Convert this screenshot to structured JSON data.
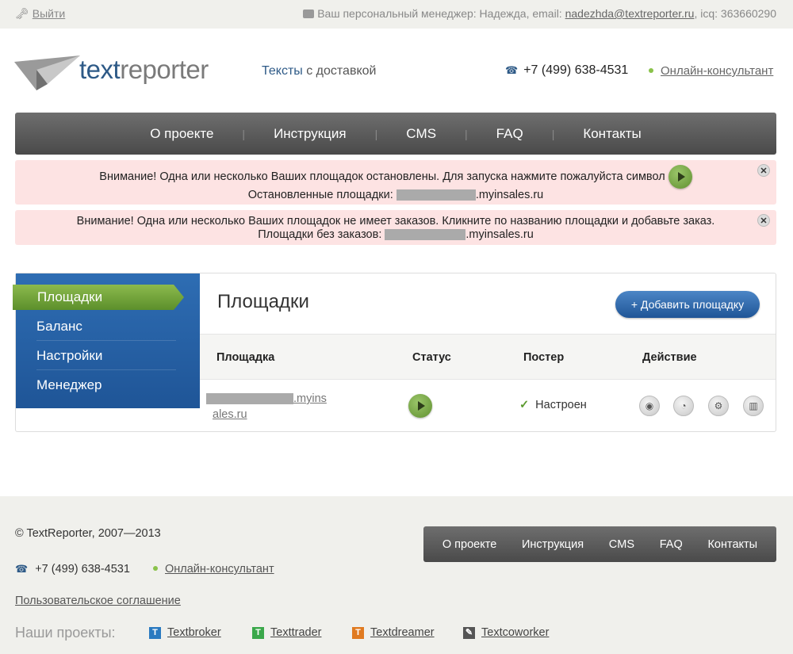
{
  "topbar": {
    "logout": "Выйти",
    "manager_text": "Ваш персональный менеджер: Надежда, email:",
    "manager_email": "nadezhda@textreporter.ru",
    "icq": ", icq: 363660290"
  },
  "header": {
    "logo_part1": "text",
    "logo_part2": "reporter",
    "tagline_hl": "Тексты",
    "tagline_rest": " с доставкой",
    "phone": "+7 (499) 638-4531",
    "online": "Онлайн-консультант"
  },
  "nav": [
    "О проекте",
    "Инструкция",
    "CMS",
    "FAQ",
    "Контакты"
  ],
  "alerts": {
    "a1_line1": "Внимание! Одна или несколько Ваших площадок остановлены. Для запуска нажмите пожалуйста символ",
    "a1_line2_prefix": "Остановленные площадки:",
    "a1_line2_suffix": ".myinsales.ru",
    "a2_line1": "Внимание! Одна или несколько Ваших площадок не имеет заказов. Кликните по названию площадки и добавьте заказ.",
    "a2_line2_prefix": "Площадки без заказов:",
    "a2_line2_suffix": ".myinsales.ru"
  },
  "sidebar": [
    "Площадки",
    "Баланс",
    "Настройки",
    "Менеджер"
  ],
  "main": {
    "title": "Площадки",
    "add_button": "+ Добавить площадку",
    "columns": [
      "Площадка",
      "Статус",
      "Постер",
      "Действие"
    ],
    "row": {
      "site_suffix1": ".myins",
      "site_suffix2": "ales.ru",
      "poster": "Настроен"
    }
  },
  "footer": {
    "copyright": "© TextReporter, 2007—2013",
    "nav": [
      "О проекте",
      "Инструкция",
      "CMS",
      "FAQ",
      "Контакты"
    ],
    "phone": "+7 (499) 638-4531",
    "online": "Онлайн-консультант",
    "agreement": "Пользовательское соглашение",
    "projects_label": "Наши проекты:",
    "projects": [
      "Textbroker",
      "Texttrader",
      "Textdreamer",
      "Textcoworker"
    ]
  },
  "colors": {
    "brand_blue": "#2e5a87",
    "alert_bg": "#fde3e3",
    "active_green": "#7aab3e"
  }
}
